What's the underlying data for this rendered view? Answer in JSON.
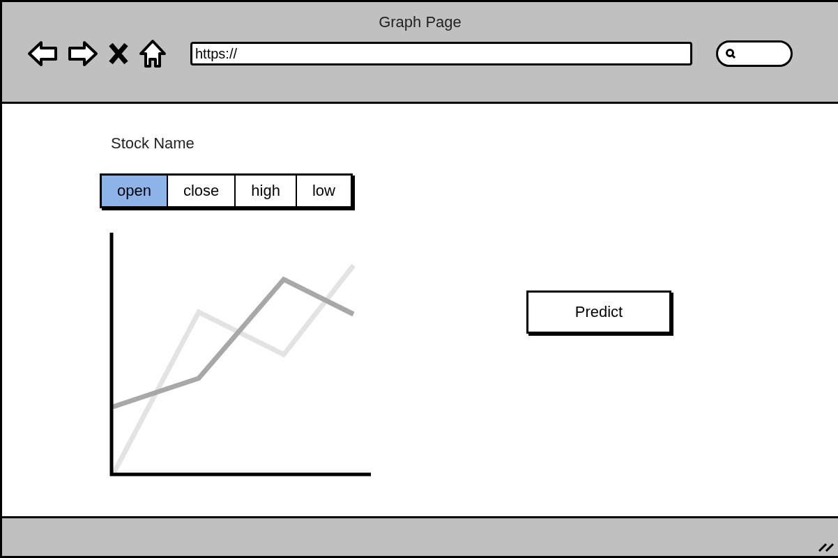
{
  "window": {
    "title": "Graph Page"
  },
  "address_bar": {
    "value": "https://"
  },
  "page": {
    "heading": "Stock Name",
    "tabs": [
      {
        "label": "open",
        "selected": true
      },
      {
        "label": "close",
        "selected": false
      },
      {
        "label": "high",
        "selected": false
      },
      {
        "label": "low",
        "selected": false
      }
    ],
    "button": "Predict"
  }
}
